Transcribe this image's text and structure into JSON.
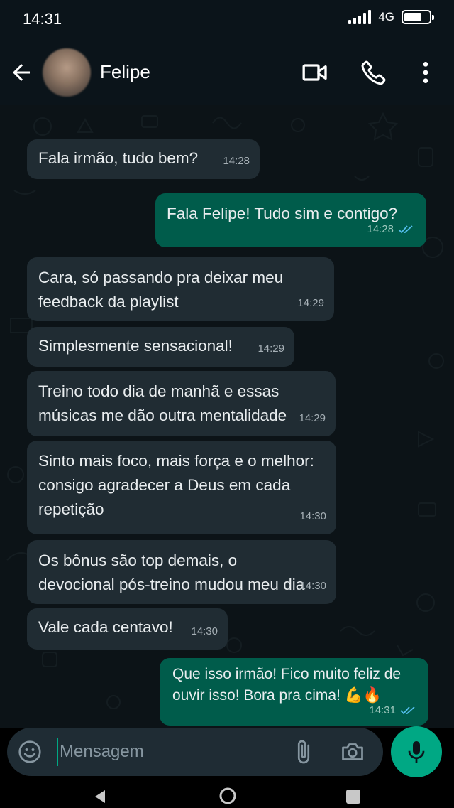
{
  "status_bar": {
    "time": "14:31",
    "network": "4G"
  },
  "header": {
    "contact_name": "Felipe"
  },
  "messages": [
    {
      "dir": "in",
      "text": "Fala irmão, tudo bem?",
      "time": "14:28"
    },
    {
      "dir": "out",
      "text": "Fala Felipe! Tudo sim e contigo?",
      "time": "14:28",
      "read": true
    },
    {
      "dir": "in",
      "text": "Cara, só passando pra deixar meu feedback da playlist",
      "time": "14:29"
    },
    {
      "dir": "in",
      "text": "Simplesmente sensacional!",
      "time": "14:29"
    },
    {
      "dir": "in",
      "text": "Treino todo dia de manhã e essas músicas me dão outra mentalidade",
      "time": "14:29"
    },
    {
      "dir": "in",
      "text": "Sinto mais foco, mais força e o melhor: consigo agradecer a Deus em cada repetição",
      "time": "14:30"
    },
    {
      "dir": "in",
      "text": "Os bônus são top demais, o devocional pós-treino mudou meu dia",
      "time": "14:30"
    },
    {
      "dir": "in",
      "text": "Vale cada centavo!",
      "time": "14:30"
    },
    {
      "dir": "out",
      "text": "Que isso irmão! Fico muito feliz de ouvir isso! Bora pra cima! 💪🔥",
      "time": "14:31",
      "read": true
    }
  ],
  "composer": {
    "placeholder": "Mensagem",
    "value": ""
  },
  "colors": {
    "incoming_bubble": "#202c33",
    "outgoing_bubble": "#005c4b",
    "accent": "#00a884",
    "read_ticks": "#53bdeb"
  },
  "icons": [
    "back-arrow-icon",
    "video-call-icon",
    "voice-call-icon",
    "more-options-icon",
    "emoji-icon",
    "attach-icon",
    "camera-icon",
    "mic-icon",
    "read-ticks-icon"
  ]
}
